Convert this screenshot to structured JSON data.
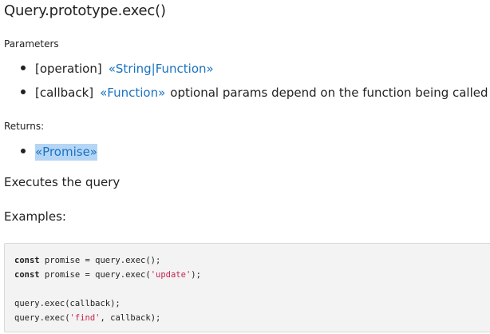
{
  "title": "Query.prototype.exec()",
  "parameters": {
    "label": "Parameters",
    "items": [
      {
        "name": "[operation]",
        "type": "«String|Function»",
        "description": ""
      },
      {
        "name": "[callback]",
        "type": "«Function»",
        "description": "optional params depend on the function being called"
      }
    ]
  },
  "returns": {
    "label": "Returns:",
    "type": "«Promise»"
  },
  "description": "Executes the query",
  "examples": {
    "label": "Examples:",
    "lines": [
      {
        "kw": "const",
        "rest": " promise = query.exec();",
        "str": "",
        "after": ""
      },
      {
        "kw": "const",
        "rest": " promise = query.exec(",
        "str": "'update'",
        "after": ");"
      },
      {
        "kw": "",
        "rest": "",
        "str": "",
        "after": ""
      },
      {
        "kw": "",
        "rest": "query.exec(callback);",
        "str": "",
        "after": ""
      },
      {
        "kw": "",
        "rest": "query.exec(",
        "str": "'find'",
        "after": ", callback);"
      }
    ]
  }
}
